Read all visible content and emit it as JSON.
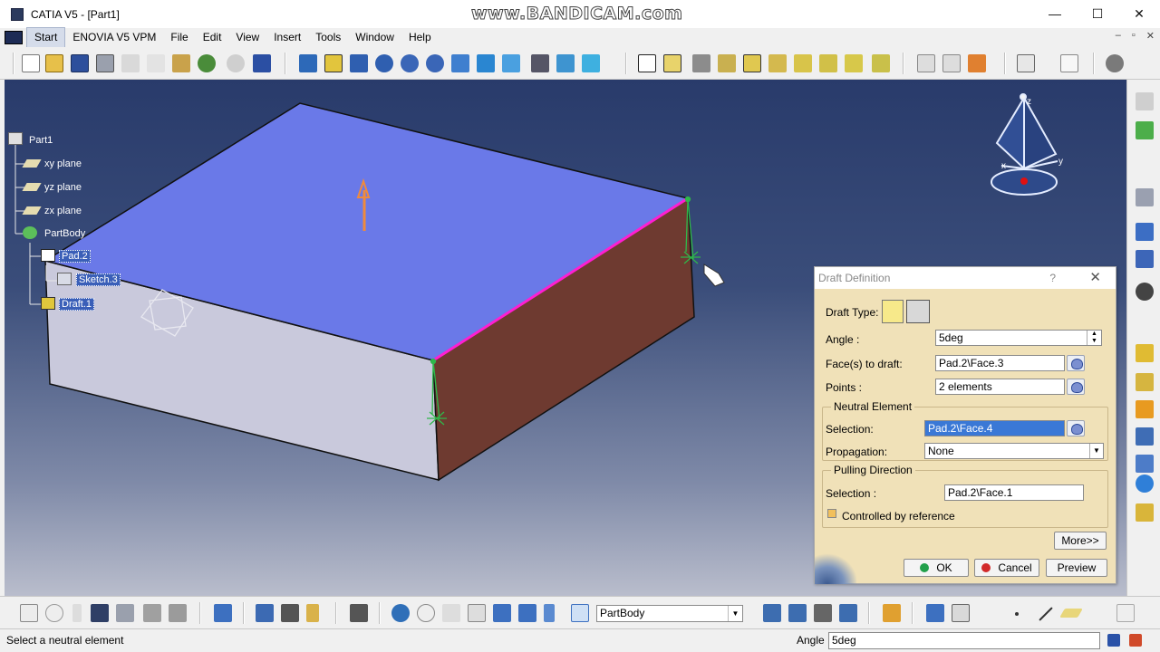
{
  "window": {
    "title": "CATIA V5 - [Part1]",
    "watermark": "www.BANDICAM.com",
    "minimize": "—",
    "maximize": "☐",
    "close": "✕"
  },
  "menu": {
    "items": [
      "Start",
      "ENOVIA V5 VPM",
      "File",
      "Edit",
      "View",
      "Insert",
      "Tools",
      "Window",
      "Help"
    ],
    "mdi_controls": [
      "–",
      "▫",
      "✕"
    ]
  },
  "tree": {
    "root": "Part1",
    "planes": [
      "xy plane",
      "yz plane",
      "zx plane"
    ],
    "body": "PartBody",
    "features": [
      "Pad.2",
      "Sketch.3",
      "Draft.1"
    ]
  },
  "compass": {
    "x_label": "x",
    "y_label": "y",
    "z_label": "z"
  },
  "dialog": {
    "title": "Draft Definition",
    "help": "?",
    "close": "✕",
    "draft_type_label": "Draft Type:",
    "angle_label": "Angle :",
    "angle_value": "5deg",
    "faces_label": "Face(s) to draft:",
    "faces_value": "Pad.2\\Face.3",
    "points_label": "Points :",
    "points_value": "2 elements",
    "neutral": {
      "title": "Neutral Element",
      "selection_label": "Selection:",
      "selection_value": "Pad.2\\Face.4",
      "propagation_label": "Propagation:",
      "propagation_value": "None"
    },
    "pulling": {
      "title": "Pulling Direction",
      "selection_label": "Selection :",
      "selection_value": "Pad.2\\Face.1",
      "controlled_label": "Controlled by reference"
    },
    "more_button": "More>>",
    "ok_button": "OK",
    "cancel_button": "Cancel",
    "preview_button": "Preview"
  },
  "bottom_toolbar": {
    "body_select": "PartBody"
  },
  "status": {
    "message": "Select a neutral element",
    "angle_label": "Angle",
    "angle_value": "5deg"
  },
  "colors": {
    "top_face": "#6a79e8",
    "front_face": "#c8c8dc",
    "side_face": "#6e3a30",
    "edge_highlight": "#ff1ed2",
    "dialog_bg": "#f0e1b8"
  }
}
